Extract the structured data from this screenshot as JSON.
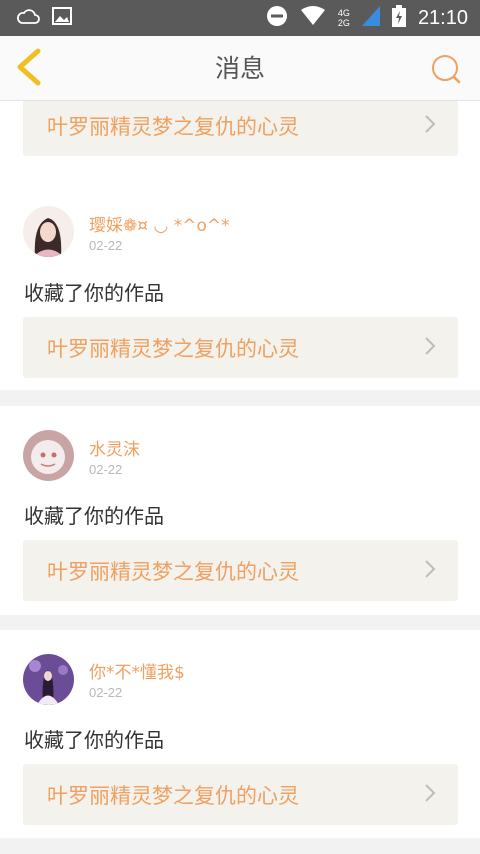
{
  "status_bar": {
    "time": "21:10",
    "network_top": "4G",
    "network_bottom": "2G",
    "icons": [
      "cloud-icon",
      "image-icon",
      "dnd-icon",
      "wifi-icon",
      "signal-icon",
      "battery-icon"
    ]
  },
  "header": {
    "title": "消息",
    "back_icon": "chevron-left-icon",
    "search_icon": "search-icon"
  },
  "colors": {
    "accent": "#f0a060",
    "back": "#f0c020",
    "status_bar": "#5a5a5a",
    "card_link_bg": "#f3f2ec"
  },
  "messages": [
    {
      "work_title": "叶罗丽精灵梦之复仇的心灵"
    },
    {
      "username": "璎婇❁¤ ◡ *^o^*",
      "date": "02-22",
      "action": "收藏了你的作品",
      "work_title": "叶罗丽精灵梦之复仇的心灵"
    },
    {
      "username": "水灵沫",
      "date": "02-22",
      "action": "收藏了你的作品",
      "work_title": "叶罗丽精灵梦之复仇的心灵"
    },
    {
      "username": "你*不*懂我$",
      "date": "02-22",
      "action": "收藏了你的作品",
      "work_title": "叶罗丽精灵梦之复仇的心灵"
    }
  ]
}
